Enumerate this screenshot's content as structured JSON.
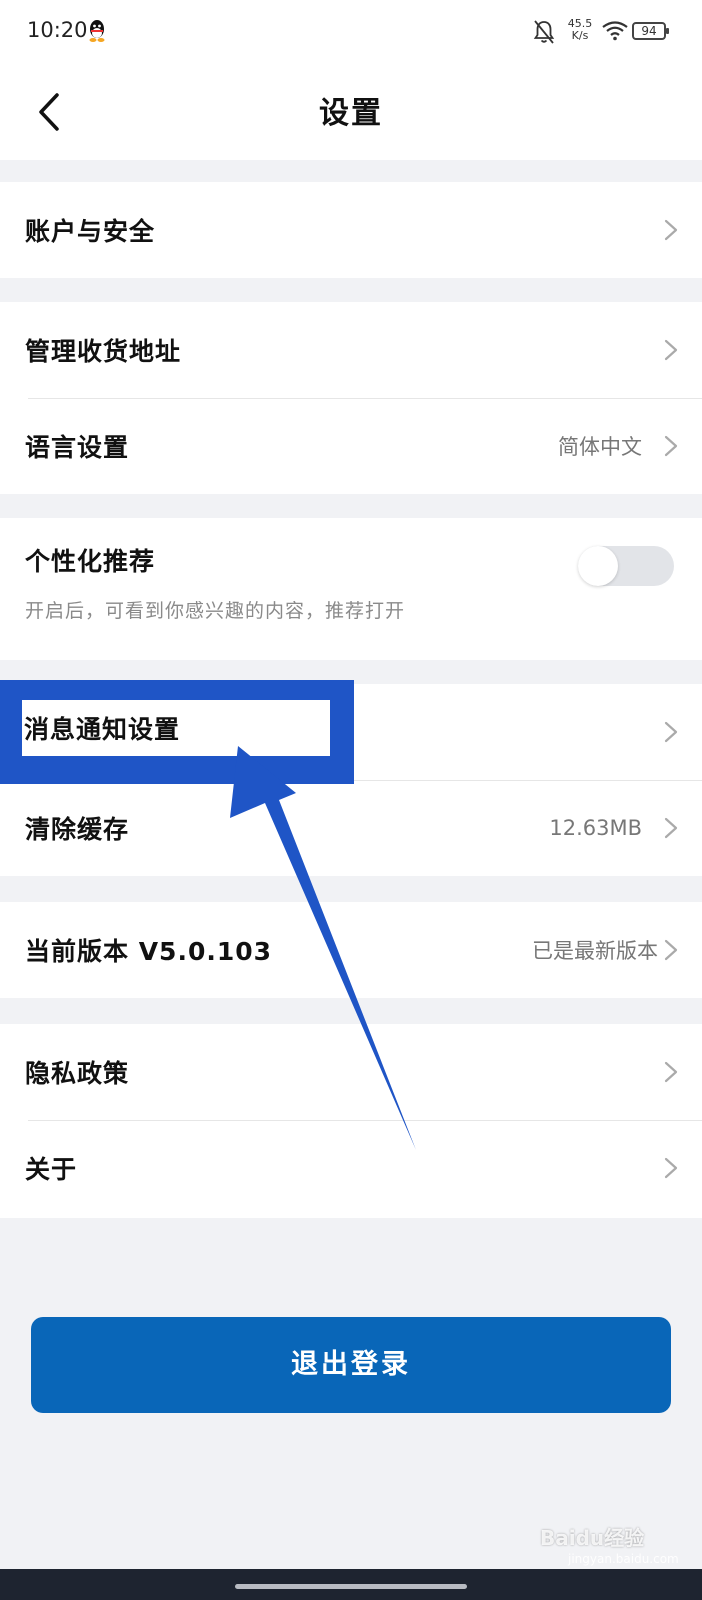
{
  "status_bar": {
    "time": "10:20",
    "net_speed_value": "45.5",
    "net_speed_unit": "K/s",
    "battery": "94",
    "icons": [
      "qq-icon",
      "bell-off-icon",
      "wifi-icon",
      "battery-icon"
    ]
  },
  "header": {
    "title": "设置",
    "back_icon": "chevron-left-icon"
  },
  "settings": {
    "account_security": {
      "label": "账户与安全"
    },
    "shipping_address": {
      "label": "管理收货地址"
    },
    "language": {
      "label": "语言设置",
      "value": "简体中文"
    },
    "personalized": {
      "label": "个性化推荐",
      "description": "开启后，可看到你感兴趣的内容，推荐打开",
      "enabled": false
    },
    "notifications": {
      "label": "消息通知设置"
    },
    "clear_cache": {
      "label": "清除缓存",
      "value": "12.63MB"
    },
    "version": {
      "label": "当前版本 V5.0.103",
      "value": "已是最新版本"
    },
    "privacy": {
      "label": "隐私政策"
    },
    "about": {
      "label": "关于"
    }
  },
  "logout_button": {
    "label": "退出登录"
  },
  "annotation": {
    "color": "#1f55c6"
  },
  "watermark": {
    "brand": "Baidu经验",
    "url": "jingyan.baidu.com"
  },
  "colors": {
    "accent": "#0966b8",
    "background": "#f1f2f5"
  }
}
